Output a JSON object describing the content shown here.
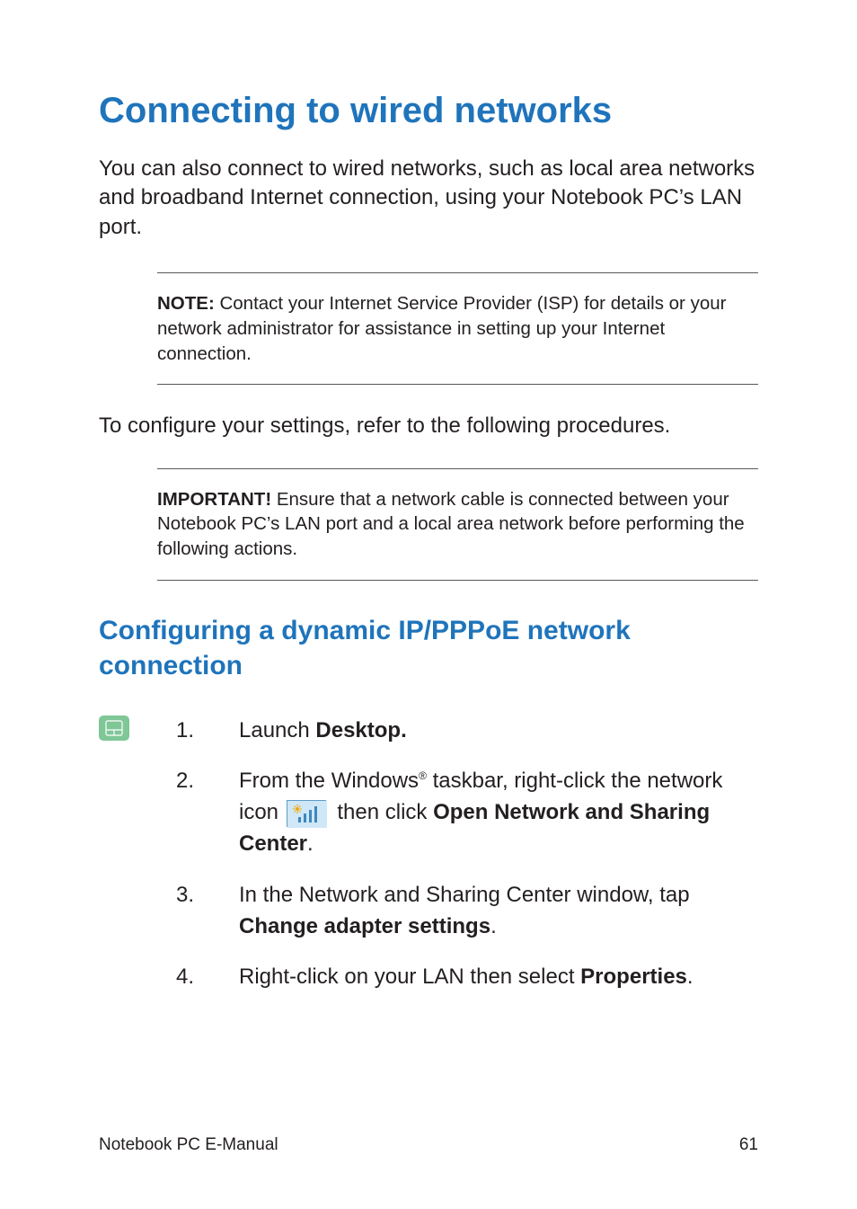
{
  "title": "Connecting to wired networks",
  "intro": "You can also connect to wired networks, such as local area networks and broadband Internet connection, using your Notebook PC’s LAN port.",
  "note_label": "NOTE:",
  "note_body": " Contact your Internet Service Provider (ISP) for details or your network administrator for assistance in setting up your Internet connection.",
  "configure_line": "To configure your settings, refer to the following procedures.",
  "important_label": "IMPORTANT!",
  "important_body": "  Ensure that a network cable is connected between your Notebook PC’s LAN port and a local area network before performing the following actions.",
  "subheading": "Configuring a dynamic IP/PPPoE network connection",
  "steps": {
    "s1": {
      "num": "1.",
      "pre": "Launch ",
      "bold": "Desktop."
    },
    "s2": {
      "num": "2.",
      "a": "From the Windows",
      "reg": "®",
      "b": " taskbar, right-click the network icon ",
      "c": " then click ",
      "bold": "Open Network and Sharing Center",
      "d": "."
    },
    "s3": {
      "num": "3.",
      "a": "In the Network and Sharing Center window, tap ",
      "bold": "Change adapter settings",
      "b": "."
    },
    "s4": {
      "num": "4.",
      "a": "Right-click on your LAN then select ",
      "bold": "Properties",
      "b": "."
    }
  },
  "footer_left": "Notebook PC E-Manual",
  "footer_right": "61"
}
